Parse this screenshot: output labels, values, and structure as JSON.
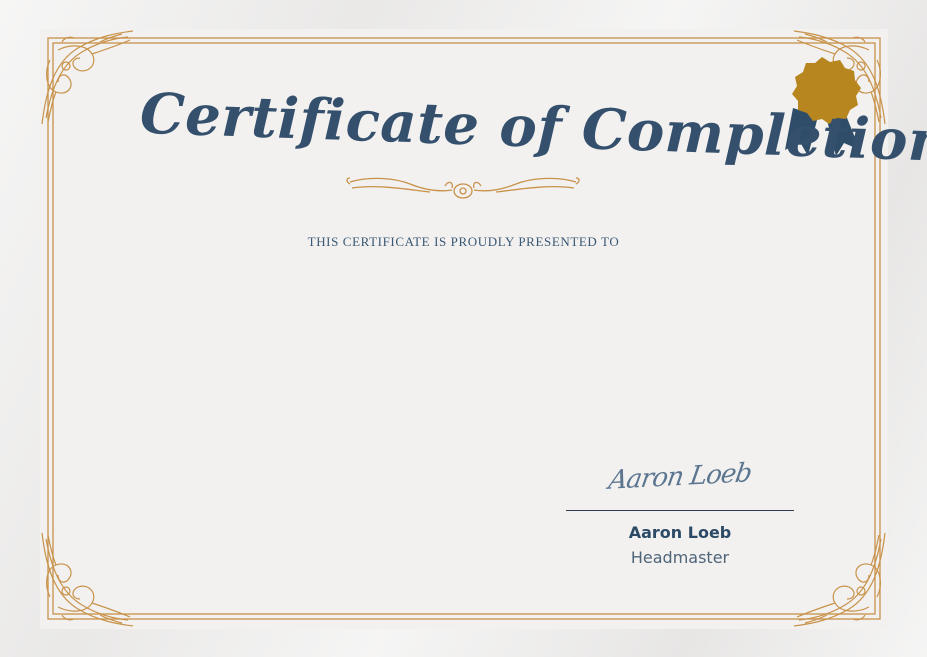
{
  "certificate": {
    "title": "Certificate of Completion",
    "subtitle": "THIS CERTIFICATE IS PROUDLY PRESENTED TO",
    "recipient_name": "",
    "signature_text": "Aaron Loeb",
    "signer_name": "Aaron Loeb",
    "signer_role": "Headmaster"
  },
  "colors": {
    "border_gold": "#c8924a",
    "seal_gold": "#b8861f",
    "ribbon_navy": "#2f4d68",
    "title_navy": "#34506c",
    "background": "#f2f1f0"
  },
  "icons": {
    "seal": "award-seal-icon",
    "corner": "ornamental-corner-icon",
    "divider": "flourish-divider-icon"
  }
}
